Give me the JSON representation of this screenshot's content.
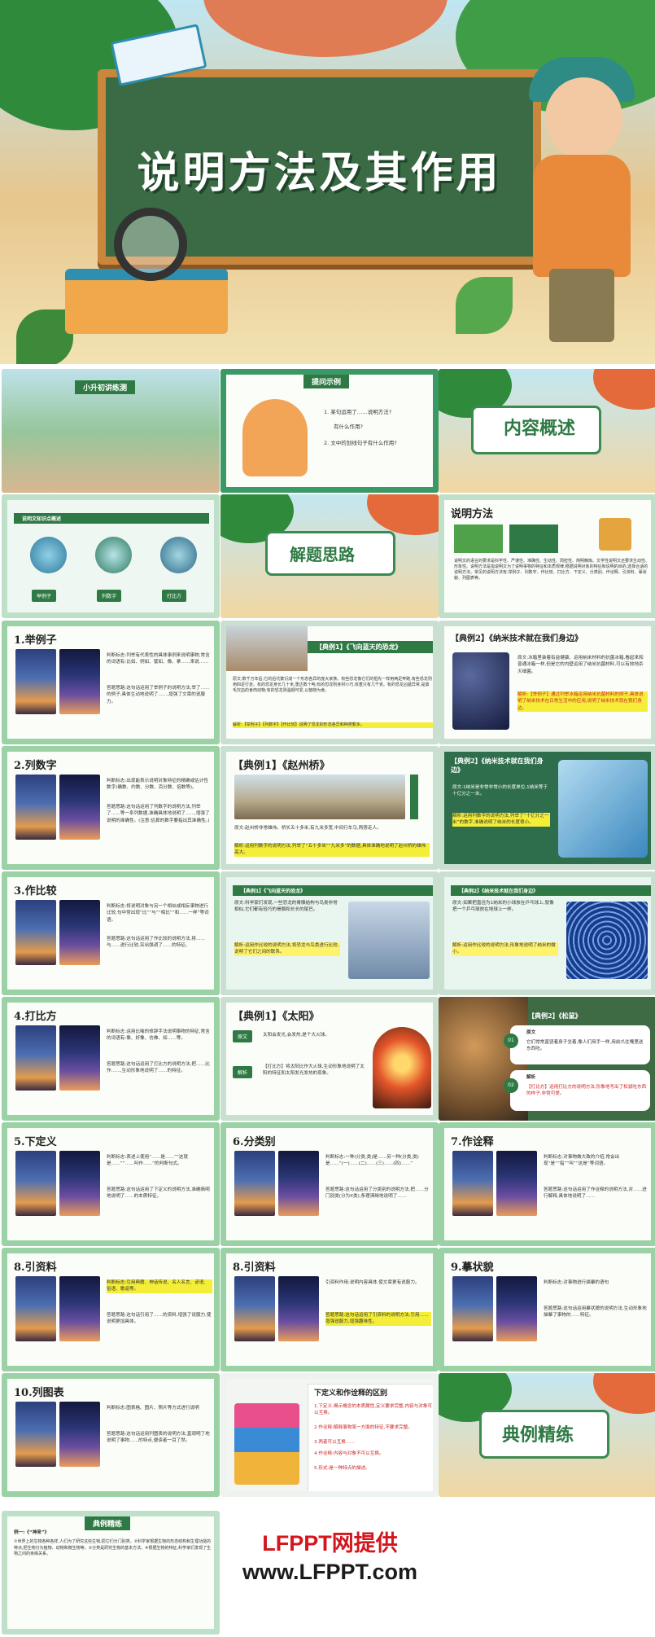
{
  "cover": {
    "title": "说明方法及其作用"
  },
  "slides": {
    "s1": {
      "banner": "小升初讲练测"
    },
    "s2": {
      "banner": "提问示例",
      "q1": "1. 某句运用了……说明方法?",
      "q1b": "有什么作用?",
      "q2": "2. 文中的划线句子有什么作用?"
    },
    "s3": {
      "title": "内容概述"
    },
    "s4": {
      "header": "说明文知识点概述",
      "tags": [
        "举例子",
        "列数字",
        "打比方"
      ]
    },
    "s5": {
      "title": "解题思路"
    },
    "s6": {
      "title": "说明方法",
      "body": "说明文的语言的要求是科学性、严谨性、准确性、生动性、周密性、简明精炼。文学性说明文还要求生动性、形象性。说明方法是指说明文为了说明事物的特征和本质规律,根据说明对象的特征和说明的目的,选择合适的说明方法。常见的说明方法有:举例子、列数字、作比较、打比方、下定义、分类别、作诠释、引资料、摹状貌、列图表等。"
    },
    "s7": {
      "title": "1.举例子",
      "t1": "判断标志:列举有代表性的具体事例来说明事物,常含的词语有:比如、例如、譬如、像、拿……来说……",
      "t2": "答题思路:这句话运用了举例子的说明方法,举了……的例子,具体生动地说明了……,增强了文章的说服力。"
    },
    "s8": {
      "title": "【典例1】《飞向蓝天的恐龙》",
      "t1": "原文:数千万年后,它的后代繁衍成一个形态各异的庞大家族。有些恐龙像它们的祖先一样用两足奔跑,有些恐龙则用四足行走。有的恐龙身长几十米,重达数十吨;有的恐龙则身材小巧,体重只有几千克。有的恐龙凶猛异常,是茹毛饮血的食肉动物;有的恐龙则温顺可爱,以植物为食。",
      "t2": "解析:【举例子】【列数字】【作比较】说明了恐龙的形态各异和种类繁多。"
    },
    "s9": {
      "title": "【典例2】《纳米技术就在我们身边》",
      "t1": "原文:冰箱里装着有益健康、运用纳米材料的抗菌冰箱,看起来和普通冰箱一样,但是它的内壁运用了纳米抗菌材料,可以有效地杀灭细菌。",
      "t2": "解析:【举例子】通过列举冰箱运用纳米抗菌材料的例子,具体说明了纳米技术在日常生活中的应用,说明了纳米技术就在我们身边。"
    },
    "s10": {
      "title": "2.列数字",
      "t1": "判断标志:出现能表示说明对象特征的精确或估计性数字(确数、约数、分数、百分数、倍数等)。",
      "t2": "答题思路:这句话运用了列数字的说明方法,列举了……等一系列数据,准确具体地说明了……,增强了说明的准确性。(注意:估算的数字要指出其准确性。)"
    },
    "s11": {
      "title": "【典例1】《赵州桥》",
      "t1": "原文:赵州桥非常雄伟。桥长五十多米,有九米多宽,中间行车马,两旁走人。",
      "t2": "解析:运用列数字的说明方法,列举了“五十多米”“九米多”的数据,具体准确地说明了赵州桥的雄伟高大。"
    },
    "s12": {
      "title": "【典例2】《纳米技术就在我们身边》",
      "t1": "原文:1纳米是非常非常小的长度单位,1纳米等于十亿分之一米。",
      "t2": "解析:运用列数字的说明方法,列举了“十亿分之一米”的数字,准确说明了纳米的长度很小。"
    },
    "s13": {
      "title": "3.作比较",
      "t1": "判断标志:将说明对象与另一个相似或相反事物进行比较,句中常出现“比”“与”“相比”“和……一样”等词语。",
      "t2": "答题思路:这句话运用了作比较的说明方法,将……与……进行比较,突出强调了……的特征。"
    },
    "s14": {
      "title": "【典例1】《飞向蓝天的恐龙》",
      "t1": "原文:科学家们发现,一些恐龙的骨骼结构与鸟类非常相似,它们都有轻巧的骨骼和长长的尾巴。",
      "t2": "解析:运用作比较的说明方法,将恐龙与鸟类进行比较,说明了它们之间的联系。"
    },
    "s15": {
      "title": "【典例2】《纳米技术就在我们身边》",
      "t1": "原文:如果把直径为1纳米的小球放在乒乓球上,就像把一个乒乓球放在地球上一样。",
      "t2": "解析:运用作比较的说明方法,形象地说明了纳米的微小。"
    },
    "s16": {
      "title": "4.打比方",
      "t1": "判断标志:运用比喻的修辞手法说明事物的特征,常含的词语有:像、好像、仿佛、如……等。",
      "t2": "答题思路:这句话运用了打比方的说明方法,把……比作……,生动形象地说明了……的特征。"
    },
    "s17": {
      "title": "【典例1】《太阳》",
      "orig_tag": "原文",
      "orig": "太阳会发光,会发热,是个大火球。",
      "ana_tag": "解析",
      "ana": "【打比方】将太阳比作大火球,生动形象地说明了太阳的特征和太阳发光发热的现象。"
    },
    "s18": {
      "title": "【典例2】《松鼠》",
      "n1": "01",
      "n1_tag": "原文",
      "n1_text": "它们常常直竖着身子坐着,像人们用手一样,用前爪往嘴里送东西吃。",
      "n2": "02",
      "n2_tag": "解析",
      "n2_text": "【打比方】运用打比方的说明方法,形象地写出了松鼠吃东西的样子,非常可爱。"
    },
    "s19": {
      "title": "5.下定义",
      "t1": "判断标志:表述上使用“……是……”“这就是……”“……叫作……”的判断句式。",
      "t2": "答题思路:这句话运用了下定义的说明方法,准确简明地说明了……的本质特征。"
    },
    "s20": {
      "title": "6.分类别",
      "t1": "判断标志:一种(分类,类)是……另一种(分类,类)是……“(一)……(二)……(三)……(四)……”",
      "t2": "答题思路:这句话运用了分类别的说明方法,把……分门别类(分为X类),条理清晰地说明了……"
    },
    "s21": {
      "title": "7.作诠释",
      "t1": "判断标志:对事物做大致的介绍,常会出现“是”“指”“叫”“这是”等词语。",
      "t2": "答题思路:这句话运用了作诠释的说明方法,对……进行解释,具体地说明了……"
    },
    "s22": {
      "title": "8.引资料",
      "t1": "判断标志:引用典籍、神话传说、名人名言、谚语、俗语、歌谣等。",
      "t2": "答题思路:这句话引用了……的资料,增强了说服力,使说明更加具体。"
    },
    "s23": {
      "title": "8.引资料",
      "t1": "引资料作用:说明内容具体,使文章更有说服力。",
      "t2": "答题思路:这句话运用了引资料的说明方法,引用……增强说服力,增强趣味性。"
    },
    "s24": {
      "title": "9.摹状貌",
      "t1": "判断标志:对事物进行描摹的语句",
      "t2": "答题思路:这句话运用摹状貌的说明方法,生动形象地描摹了事物的……特征。"
    },
    "s25": {
      "title": "10.列图表",
      "t1": "判断标志:图表格、图片、照片等方式进行说明",
      "t2": "答题思路:这句话运用列图表的说明方法,直观明了地说明了事物……的特点,便读者一目了然。"
    },
    "s26": {
      "title": "下定义和作诠释的区别",
      "items": [
        "1.下定义:揭示概念的本质属性,定义要求完整,内容与对象可以互换。",
        "2.作诠释:解释事物某一方面的特征,不要求完整。",
        "3.两者可以互换……",
        "4.作诠释:内容与对象不可以互换。",
        "5.形式:是一种特点的描述。"
      ]
    },
    "s27": {
      "title": "典例精练"
    },
    "s28": {
      "banner": "典例精练",
      "label": "例一:《“神来”》",
      "body": "①世界上的生物各种各样,人们为了研究这些生物,把它们分门别类。②科学家根据生物的形态结构和生理功能的特点,把生物分为植物、动物和微生物等。③分类是研究生物的基本方法。④根据生物的特征,科学家们发现了生物之间的亲缘关系。"
    }
  },
  "footer": {
    "line1": "LFPPT网提供",
    "line2": "www.LFPPT.com"
  }
}
